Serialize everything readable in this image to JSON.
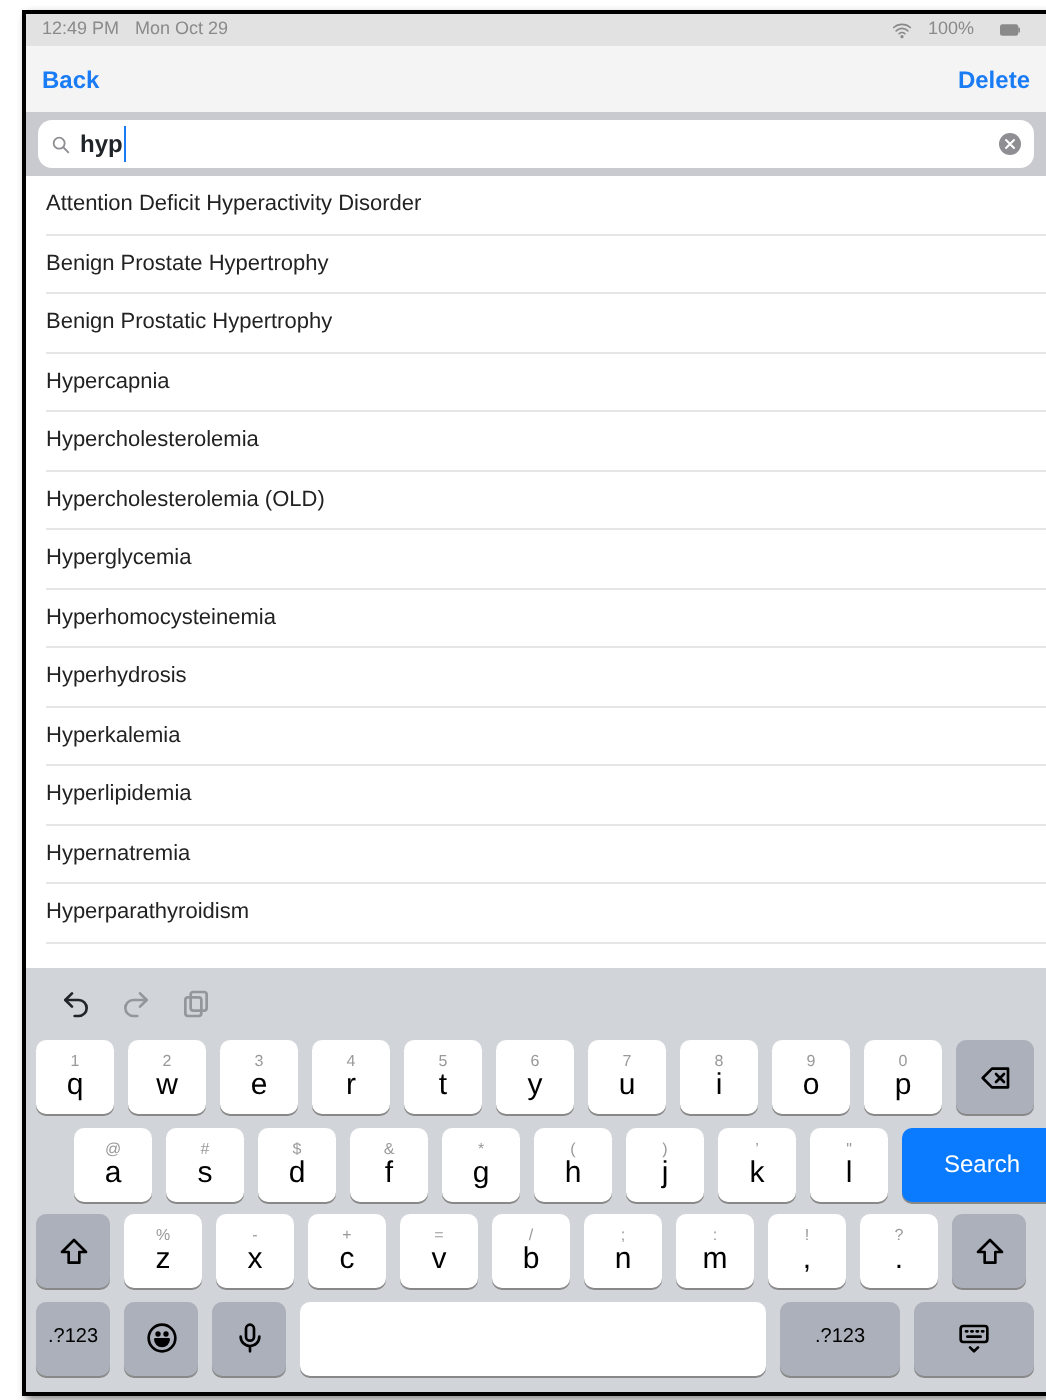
{
  "status_bar": {
    "time": "12:49 PM",
    "date": "Mon Oct 29",
    "battery": "100%"
  },
  "nav_bar": {
    "back": "Back",
    "action": "Delete"
  },
  "search": {
    "value": "hyp"
  },
  "results": [
    "Attention Deficit Hyperactivity Disorder",
    "Benign Prostate Hypertrophy",
    "Benign Prostatic Hypertrophy",
    "Hypercapnia",
    "Hypercholesterolemia",
    "Hypercholesterolemia (OLD)",
    "Hyperglycemia",
    "Hyperhomocysteinemia",
    "Hyperhydrosis",
    "Hyperkalemia",
    "Hyperlipidemia",
    "Hypernatremia",
    "Hyperparathyroidism"
  ],
  "keyboard": {
    "toolbar": [
      {
        "kind": "undo",
        "disabled": false
      },
      {
        "kind": "redo",
        "disabled": true
      },
      {
        "kind": "paste",
        "disabled": true
      }
    ],
    "rows": [
      [
        {
          "kind": "char",
          "main": "q",
          "alt": "1"
        },
        {
          "kind": "char",
          "main": "w",
          "alt": "2"
        },
        {
          "kind": "char",
          "main": "e",
          "alt": "3"
        },
        {
          "kind": "char",
          "main": "r",
          "alt": "4"
        },
        {
          "kind": "char",
          "main": "t",
          "alt": "5"
        },
        {
          "kind": "char",
          "main": "y",
          "alt": "6"
        },
        {
          "kind": "char",
          "main": "u",
          "alt": "7"
        },
        {
          "kind": "char",
          "main": "i",
          "alt": "8"
        },
        {
          "kind": "char",
          "main": "o",
          "alt": "9"
        },
        {
          "kind": "char",
          "main": "p",
          "alt": "0"
        },
        {
          "kind": "backspace"
        }
      ],
      [
        {
          "kind": "char",
          "main": "a",
          "alt": "@"
        },
        {
          "kind": "char",
          "main": "s",
          "alt": "#"
        },
        {
          "kind": "char",
          "main": "d",
          "alt": "$"
        },
        {
          "kind": "char",
          "main": "f",
          "alt": "&"
        },
        {
          "kind": "char",
          "main": "g",
          "alt": "*"
        },
        {
          "kind": "char",
          "main": "h",
          "alt": "("
        },
        {
          "kind": "char",
          "main": "j",
          "alt": ")"
        },
        {
          "kind": "char",
          "main": "k",
          "alt": "’"
        },
        {
          "kind": "char",
          "main": "l",
          "alt": "\""
        },
        {
          "kind": "search",
          "label": "Search"
        }
      ],
      [
        {
          "kind": "shift"
        },
        {
          "kind": "char",
          "main": "z",
          "alt": "%"
        },
        {
          "kind": "char",
          "main": "x",
          "alt": "-"
        },
        {
          "kind": "char",
          "main": "c",
          "alt": "+"
        },
        {
          "kind": "char",
          "main": "v",
          "alt": "="
        },
        {
          "kind": "char",
          "main": "b",
          "alt": "/"
        },
        {
          "kind": "char",
          "main": "n",
          "alt": ";"
        },
        {
          "kind": "char",
          "main": "m",
          "alt": ":"
        },
        {
          "kind": "char",
          "main": ",",
          "alt": "!"
        },
        {
          "kind": "char",
          "main": ".",
          "alt": "?"
        },
        {
          "kind": "shift"
        }
      ],
      [
        {
          "kind": "numbers",
          "label": ".?123"
        },
        {
          "kind": "emoji"
        },
        {
          "kind": "mic"
        },
        {
          "kind": "space"
        },
        {
          "kind": "numbers",
          "label": ".?123"
        },
        {
          "kind": "hide"
        }
      ]
    ]
  }
}
